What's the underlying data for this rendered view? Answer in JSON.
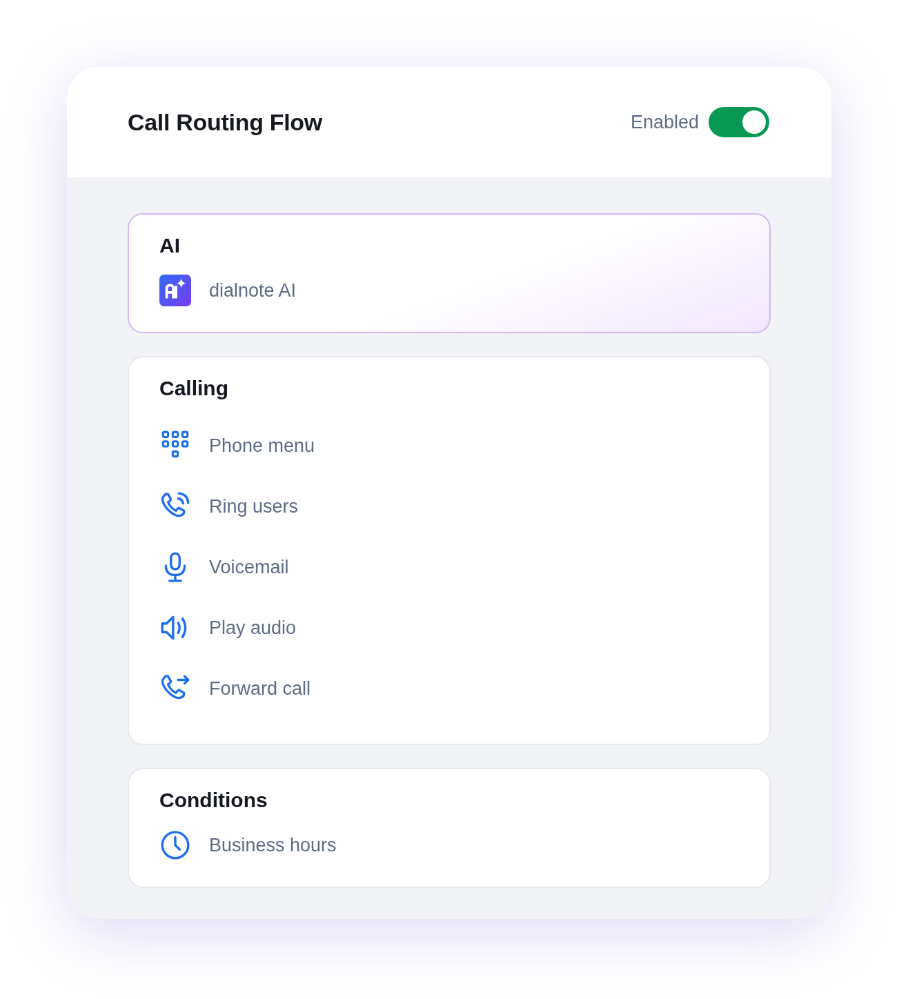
{
  "header": {
    "title": "Call Routing Flow",
    "toggle_label": "Enabled",
    "toggle_on": true
  },
  "sections": [
    {
      "kind": "ai",
      "title": "AI",
      "items": [
        {
          "label": "dialnote AI"
        }
      ]
    },
    {
      "kind": "calling",
      "title": "Calling",
      "items": [
        {
          "label": "Phone menu"
        },
        {
          "label": "Ring users"
        },
        {
          "label": "Voicemail"
        },
        {
          "label": "Play audio"
        },
        {
          "label": "Forward call"
        }
      ]
    },
    {
      "kind": "conditions",
      "title": "Conditions",
      "items": [
        {
          "label": "Business hours"
        }
      ]
    }
  ]
}
